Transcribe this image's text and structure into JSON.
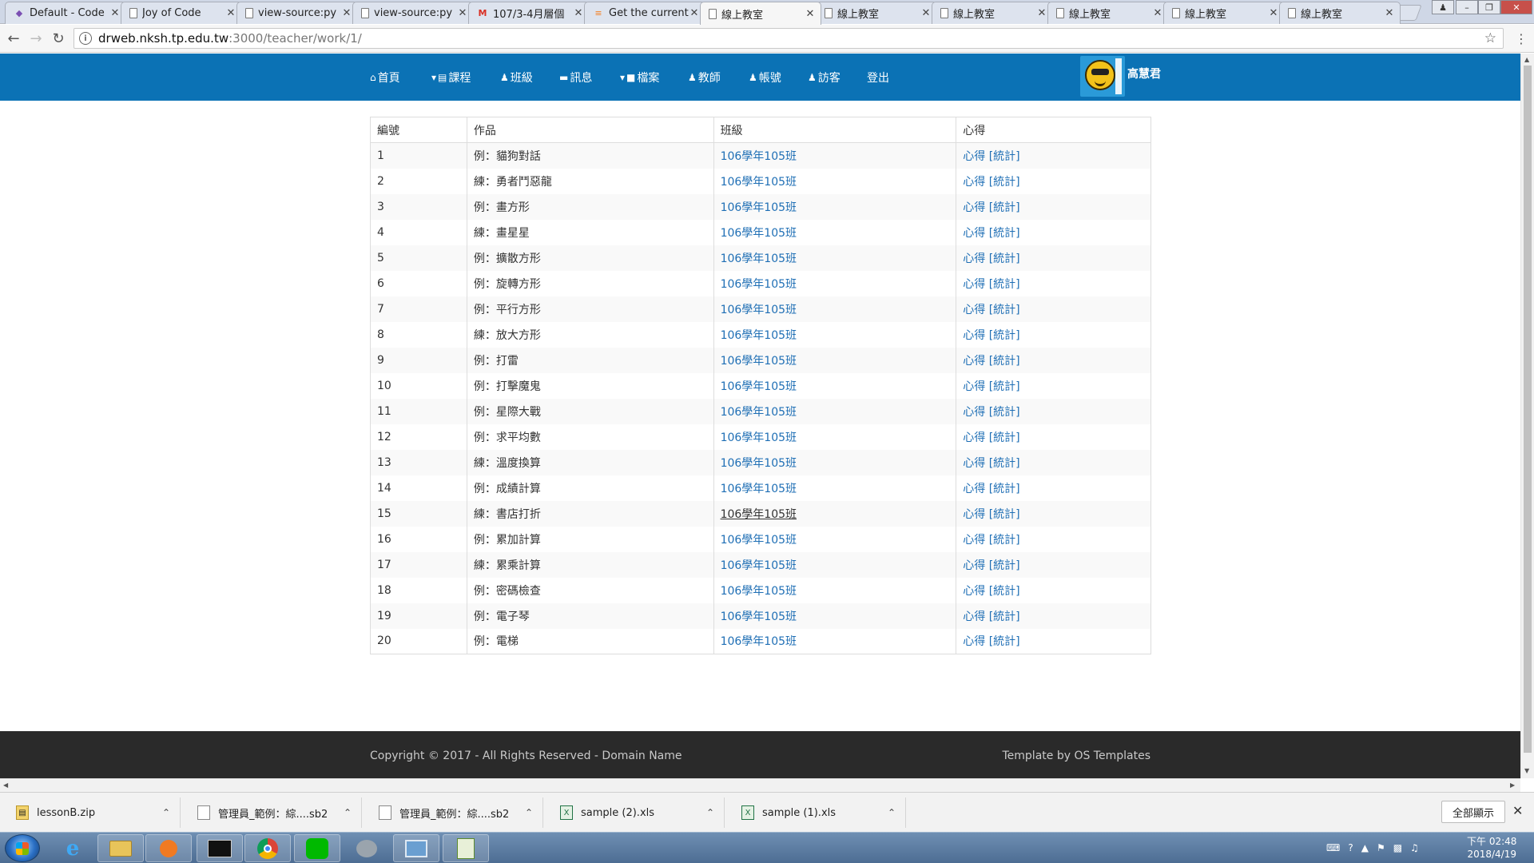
{
  "browser": {
    "tabs": [
      {
        "title": "Default - Code",
        "icon": "purple-cube"
      },
      {
        "title": "Joy of Code",
        "icon": "page"
      },
      {
        "title": "view-source:py",
        "icon": "page"
      },
      {
        "title": "view-source:py",
        "icon": "page"
      },
      {
        "title": "107/3-4月層個",
        "icon": "gmail"
      },
      {
        "title": "Get the current",
        "icon": "stack"
      },
      {
        "title": "線上教室",
        "icon": "page",
        "active": true
      },
      {
        "title": "線上教室",
        "icon": "page"
      },
      {
        "title": "線上教室",
        "icon": "page"
      },
      {
        "title": "線上教室",
        "icon": "page"
      },
      {
        "title": "線上教室",
        "icon": "page"
      },
      {
        "title": "線上教室",
        "icon": "page"
      }
    ],
    "url_host": "drweb.nksh.tp.edu.tw",
    "url_path": ":3000/teacher/work/1/"
  },
  "nav": {
    "items": [
      {
        "label": "首頁",
        "icon": "home-icon"
      },
      {
        "label": "課程",
        "icon": "book-icon",
        "caret": true
      },
      {
        "label": "班級",
        "icon": "group-icon"
      },
      {
        "label": "訊息",
        "icon": "message-icon"
      },
      {
        "label": "檔案",
        "icon": "file-icon",
        "caret": true
      },
      {
        "label": "教師",
        "icon": "teacher-icon"
      },
      {
        "label": "帳號",
        "icon": "user-icon"
      },
      {
        "label": "訪客",
        "icon": "guest-icon"
      },
      {
        "label": "登出",
        "icon": ""
      }
    ],
    "username": "高慧君"
  },
  "table": {
    "headers": [
      "編號",
      "作品",
      "班級",
      "心得"
    ],
    "rows": [
      {
        "no": "1",
        "work": "例：貓狗對話",
        "class": "106學年105班"
      },
      {
        "no": "2",
        "work": "練：勇者鬥惡龍",
        "class": "106學年105班"
      },
      {
        "no": "3",
        "work": "例：畫方形",
        "class": "106學年105班"
      },
      {
        "no": "4",
        "work": "練：畫星星",
        "class": "106學年105班"
      },
      {
        "no": "5",
        "work": "例：擴散方形",
        "class": "106學年105班"
      },
      {
        "no": "6",
        "work": "例：旋轉方形",
        "class": "106學年105班"
      },
      {
        "no": "7",
        "work": "例：平行方形",
        "class": "106學年105班"
      },
      {
        "no": "8",
        "work": "練：放大方形",
        "class": "106學年105班"
      },
      {
        "no": "9",
        "work": "例：打雷",
        "class": "106學年105班"
      },
      {
        "no": "10",
        "work": "例：打擊魔鬼",
        "class": "106學年105班"
      },
      {
        "no": "11",
        "work": "例：星際大戰",
        "class": "106學年105班"
      },
      {
        "no": "12",
        "work": "例：求平均數",
        "class": "106學年105班"
      },
      {
        "no": "13",
        "work": "練：溫度換算",
        "class": "106學年105班"
      },
      {
        "no": "14",
        "work": "例：成績計算",
        "class": "106學年105班"
      },
      {
        "no": "15",
        "work": "練：書店打折",
        "class": "106學年105班",
        "hover": true
      },
      {
        "no": "16",
        "work": "例：累加計算",
        "class": "106學年105班"
      },
      {
        "no": "17",
        "work": "練：累乘計算",
        "class": "106學年105班"
      },
      {
        "no": "18",
        "work": "例：密碼檢查",
        "class": "106學年105班"
      },
      {
        "no": "19",
        "work": "例：電子琴",
        "class": "106學年105班"
      },
      {
        "no": "20",
        "work": "例：電梯",
        "class": "106學年105班"
      }
    ],
    "reflection_label": "心得",
    "stats_label": "[統計]"
  },
  "footer": {
    "copyright": "Copyright © 2017 - All Rights Reserved - Domain Name",
    "template": "Template by OS Templates"
  },
  "downloads": {
    "items": [
      {
        "name": "lessonB.zip",
        "icon": "zip-icon"
      },
      {
        "name": "管理員_範例：綜....sb2",
        "icon": "file-icon"
      },
      {
        "name": "管理員_範例：綜....sb2",
        "icon": "file-icon"
      },
      {
        "name": "sample (2).xls",
        "icon": "excel-icon"
      },
      {
        "name": "sample (1).xls",
        "icon": "excel-icon"
      }
    ],
    "show_all": "全部顯示"
  },
  "taskbar": {
    "time": "下午 02:48",
    "date": "2018/4/19"
  },
  "colors": {
    "nav_bg": "#0b72b5",
    "link": "#1f6fb5",
    "footer_bg": "#2a2a2a"
  }
}
